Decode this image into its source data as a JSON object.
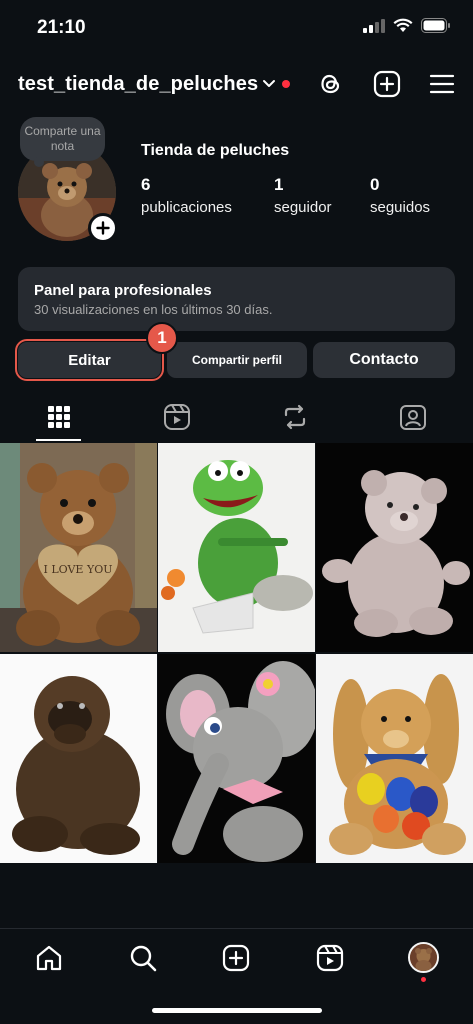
{
  "status_bar": {
    "time": "21:10"
  },
  "header": {
    "username": "test_tienda_de_peluches"
  },
  "note": {
    "text": "Comparte una nota"
  },
  "profile": {
    "name": "Tienda de peluches"
  },
  "stats": [
    {
      "value": "6",
      "label": "publicaciones"
    },
    {
      "value": "1",
      "label": "seguidor"
    },
    {
      "value": "0",
      "label": "seguidos"
    }
  ],
  "pro_panel": {
    "title": "Panel para profesionales",
    "subtitle": "30 visualizaciones en los últimos 30 días."
  },
  "buttons": {
    "edit": "Editar",
    "share": "Compartir perfil",
    "contact": "Contacto"
  },
  "annotation": {
    "step": "1"
  },
  "tabs": [
    "grid-icon",
    "reels-icon",
    "reposts-icon",
    "tagged-icon"
  ],
  "posts": [
    {
      "subject": "brown teddy bear holding heart",
      "heart_text": "I LOVE YOU"
    },
    {
      "subject": "green frog plush"
    },
    {
      "subject": "grey teddy bear on black"
    },
    {
      "subject": "dark brown gorilla plush"
    },
    {
      "subject": "grey elephant with pink bow"
    },
    {
      "subject": "tan bunny with easter eggs"
    }
  ],
  "bottom_nav": [
    "home-icon",
    "search-icon",
    "create-icon",
    "reels-icon",
    "profile-avatar"
  ],
  "colors": {
    "background": "#0c1014",
    "accent_red": "#ff3040",
    "annotation": "#e5584a",
    "button_bg": "#2c3036"
  }
}
